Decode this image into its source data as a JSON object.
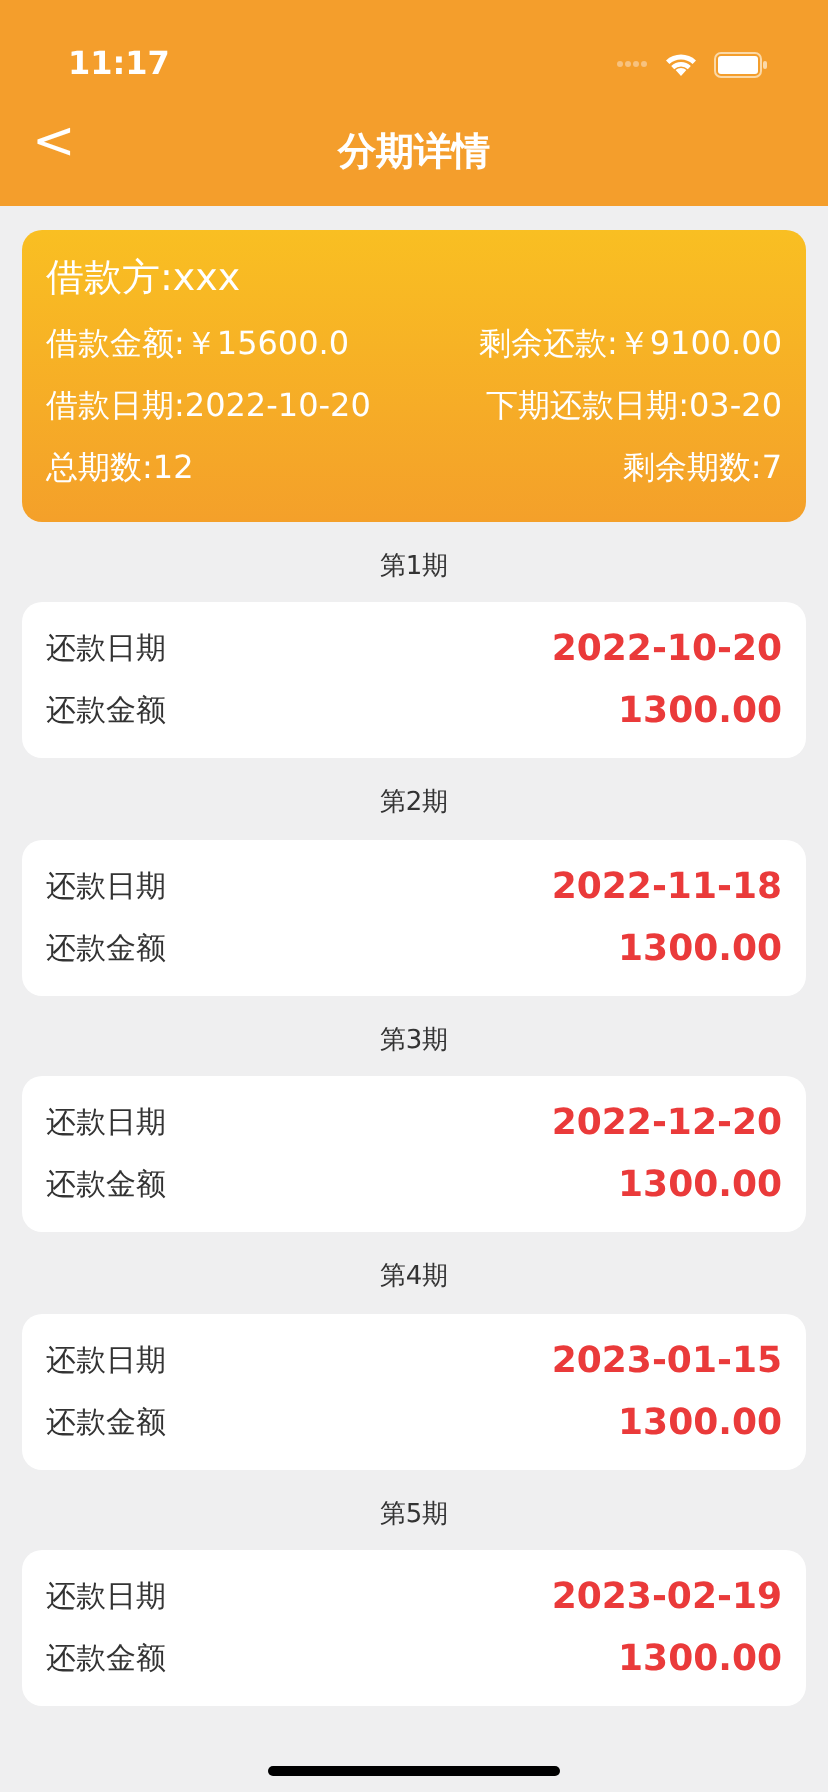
{
  "status_bar": {
    "time": "11:17"
  },
  "nav": {
    "back": "<",
    "title": "分期详情"
  },
  "summary": {
    "borrower": "借款方:xxx",
    "rows": [
      {
        "left": "借款金额:￥15600.0",
        "right": "剩余还款:￥9100.00"
      },
      {
        "left": "借款日期:2022-10-20",
        "right": "下期还款日期:03-20"
      },
      {
        "left": "总期数:12",
        "right": "剩余期数:7"
      }
    ]
  },
  "periods": [
    {
      "title": "第1期",
      "date_label": "还款日期",
      "date": "2022-10-20",
      "amount_label": "还款金额",
      "amount": "1300.00"
    },
    {
      "title": "第2期",
      "date_label": "还款日期",
      "date": "2022-11-18",
      "amount_label": "还款金额",
      "amount": "1300.00"
    },
    {
      "title": "第3期",
      "date_label": "还款日期",
      "date": "2022-12-20",
      "amount_label": "还款金额",
      "amount": "1300.00"
    },
    {
      "title": "第4期",
      "date_label": "还款日期",
      "date": "2023-01-15",
      "amount_label": "还款金额",
      "amount": "1300.00"
    },
    {
      "title": "第5期",
      "date_label": "还款日期",
      "date": "2023-02-19",
      "amount_label": "还款金额",
      "amount": "1300.00"
    }
  ]
}
